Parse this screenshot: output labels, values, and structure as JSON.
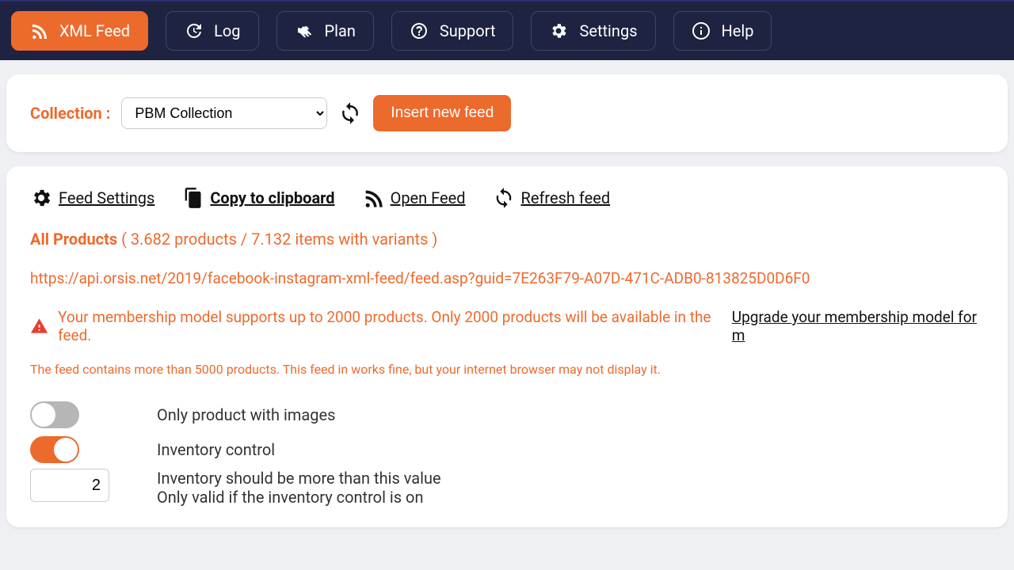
{
  "nav": {
    "xml_feed": "XML Feed",
    "log": "Log",
    "plan": "Plan",
    "support": "Support",
    "settings": "Settings",
    "help": "Help"
  },
  "collection_label": "Collection :",
  "collection_selected": "PBM Collection",
  "insert_btn": "Insert new feed",
  "actions": {
    "feed_settings": "Feed Settings",
    "copy": "Copy to clipboard",
    "open": "Open Feed",
    "refresh": "Refresh feed"
  },
  "products_title": "All Products",
  "products_counts": "( 3.682 products / 7.132 items with variants )",
  "feed_url": "https://api.orsis.net/2019/facebook-instagram-xml-feed/feed.asp?guid=7E263F79-A07D-471C-ADB0-813825D0D6F0",
  "membership_warning": "Your membership model supports up to 2000 products. Only 2000 products will be available in the feed.",
  "upgrade_link": "Upgrade your membership model for m",
  "browser_note": "The feed contains more than 5000 products. This feed in works fine, but your internet browser may not display it.",
  "options": {
    "only_images_label": "Only product with images",
    "only_images_on": false,
    "inventory_control_label": "Inventory control",
    "inventory_control_on": true,
    "threshold_value": "2",
    "threshold_line1": "Inventory should be more than this value",
    "threshold_line2": "Only valid if the inventory control is on"
  }
}
